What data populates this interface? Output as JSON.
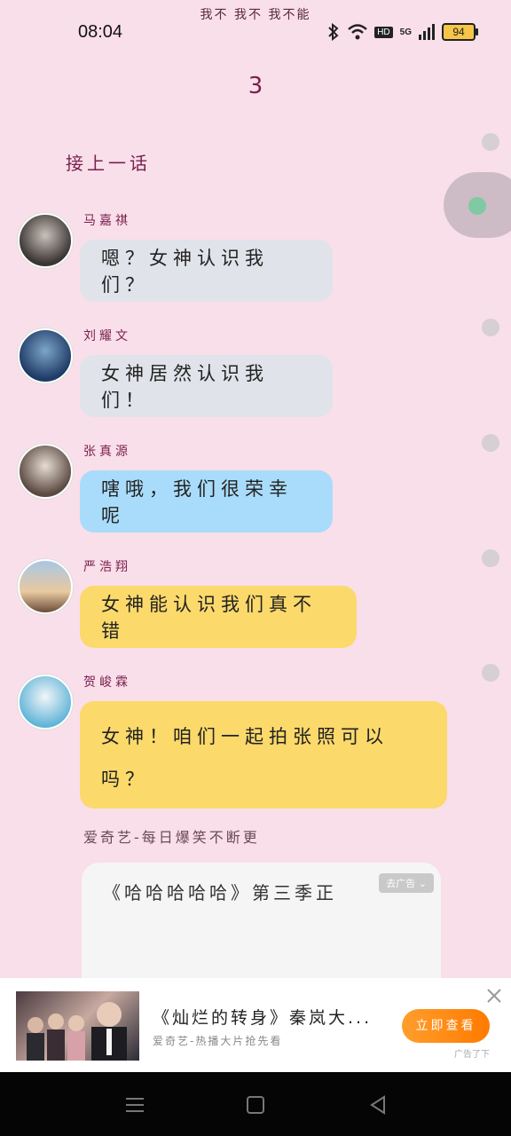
{
  "status_bar": {
    "time": "08:04",
    "slogan": "我不 我不 我不能",
    "network_badge": "HD",
    "network_type": "5G",
    "battery": "94"
  },
  "chapter": {
    "number": "3",
    "prev_link": "接上一话"
  },
  "messages": [
    {
      "name": "马嘉祺",
      "text": "嗯？女神认识我们？",
      "style": "gray"
    },
    {
      "name": "刘耀文",
      "text": "女神居然认识我们！",
      "style": "gray"
    },
    {
      "name": "张真源",
      "text": "嗐哦，我们很荣幸呢",
      "style": "blue"
    },
    {
      "name": "严浩翔",
      "text": "女神能认识我们真不错",
      "style": "yellow"
    },
    {
      "name": "贺峻霖",
      "text_line1": "女神！咱们一起拍张照可以",
      "text_line2": "吗？",
      "style": "yellow"
    }
  ],
  "inline_ad": {
    "source": "爱奇艺-每日爆笑不断更",
    "title": "《哈哈哈哈哈》第三季正",
    "tag": "去广告"
  },
  "bottom_ad": {
    "title": "《灿烂的转身》秦岚大...",
    "subtitle": "爱奇艺-热播大片抢先看",
    "button": "立即查看",
    "mark": "广告了下"
  },
  "colors": {
    "background": "#f9dfe9",
    "accent": "#7a1f4e",
    "bubble_gray": "#e1e3ea",
    "bubble_blue": "#a9dcfb",
    "bubble_yellow": "#fbd96b",
    "ad_button": "#ff8a00"
  },
  "icons": [
    "bluetooth-icon",
    "wifi-icon",
    "signal-icon",
    "battery-icon",
    "close-icon",
    "menu-icon",
    "home-icon",
    "back-icon"
  ]
}
